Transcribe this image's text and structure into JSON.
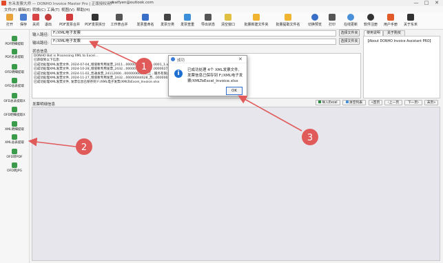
{
  "window": {
    "title": "东禾发票大师 — DONHO Invoice Master Pro | 正版授权用户",
    "user_email": "chaifyen@outlook.com",
    "controls": [
      "—",
      "□",
      "✕"
    ]
  },
  "menu": [
    "文件(F)",
    "编辑(E)",
    "转换(C)",
    "工具(T)",
    "视图(V)",
    "帮助(H)"
  ],
  "toolbar": [
    {
      "label": "打开",
      "color": "#e8a33a"
    },
    {
      "label": "保存",
      "color": "#4c7fd1"
    },
    {
      "label": "关闭",
      "color": "#d94444"
    },
    {
      "label": "退出",
      "color": "#c23b3b"
    },
    {
      "label": "PDF发票合并",
      "color": "#d23c3c"
    },
    {
      "label": "PDF发票拆分",
      "color": "#333333"
    },
    {
      "label": "工作表合并",
      "color": "#555555"
    },
    {
      "label": "发票重命名",
      "color": "#3a6fc8"
    },
    {
      "label": "发票分类",
      "color": "#444444"
    },
    {
      "label": "发票查重",
      "color": "#3a8fd8"
    },
    {
      "label": "导出状态",
      "color": "#555555"
    },
    {
      "label": "清空窗口",
      "color": "#e0c040"
    },
    {
      "label": "批量新建文件夹",
      "color": "#f0b430"
    },
    {
      "label": "批量提取文件名",
      "color": "#f0b430"
    },
    {
      "label": "切换预览",
      "color": "#3a6fc8"
    },
    {
      "label": "打印",
      "color": "#555555"
    },
    {
      "label": "在线更新",
      "color": "#4a90d9"
    },
    {
      "label": "软件注册",
      "color": "#333333"
    },
    {
      "label": "用户手册",
      "color": "#e05a2a"
    },
    {
      "label": "关于东禾",
      "color": "#333333"
    }
  ],
  "sidebar": [
    "PDF明细提取",
    "PDF总表提取",
    "OFD明细提取",
    "OFD总表提取",
    "OFD总表提取X",
    "OFD明细提取X",
    "XML明细提取",
    "XML总表提取",
    "OFD转PDF",
    "OFD转JPG"
  ],
  "inputs": {
    "input_label": "输入路径:",
    "input_value": "F:/XML电子发票",
    "output_label": "输出路径:",
    "output_value": "F:/XML电子发票",
    "browse_label": "选择文件夹"
  },
  "status": {
    "header": "状态信息",
    "lines": [
      "DONHO Bot is Processing XML to Excel...",
      "已获取到以下信息:",
      "已成功处理XML发票文件, 2024-07-04_增值税专用发票_2411...0000048618_江...0001_1.xml",
      "已成功处理XML发票文件, 2024-10-28_增值税专用发票_2432...0000056280_中...0000027_23094_48_2.xml",
      "已成功处理XML发票文件, 2024-11-02_普通发票_24112000...00000066628_江...服务有限公司_2.xml",
      "已成功处理XML发票文件, 2024-11-27_增值税专用发票_2432...00000044628_苏...0000003_4260_00_4.xml",
      "已成功处理XML发票文件, 发票信息已保存到 F:/XML电子发票/XMLToExcel_Invoice.xlsx"
    ]
  },
  "preview_tabs": [
    "使用说明",
    "关于购买"
  ],
  "preview_text": "【About DONHO Invoice Assistant PRO】",
  "details": {
    "header": "发票明细信息",
    "buttons": [
      "导入Excel",
      "清空列表",
      "首页",
      "上一页",
      "下一页",
      "末页"
    ]
  },
  "dialog": {
    "title": "成功",
    "message": "已成功处理 4个 XML发票文件, 发票信息已保存到 F:/XML电子发票/XMLToExcel_Invoice.xlsx",
    "ok_label": "OK",
    "close_glyph": "✕"
  },
  "annotations": [
    {
      "label": "1",
      "color": "#e05a5a"
    },
    {
      "label": "2",
      "color": "#e05a5a"
    },
    {
      "label": "3",
      "color": "#e05a5a"
    }
  ]
}
